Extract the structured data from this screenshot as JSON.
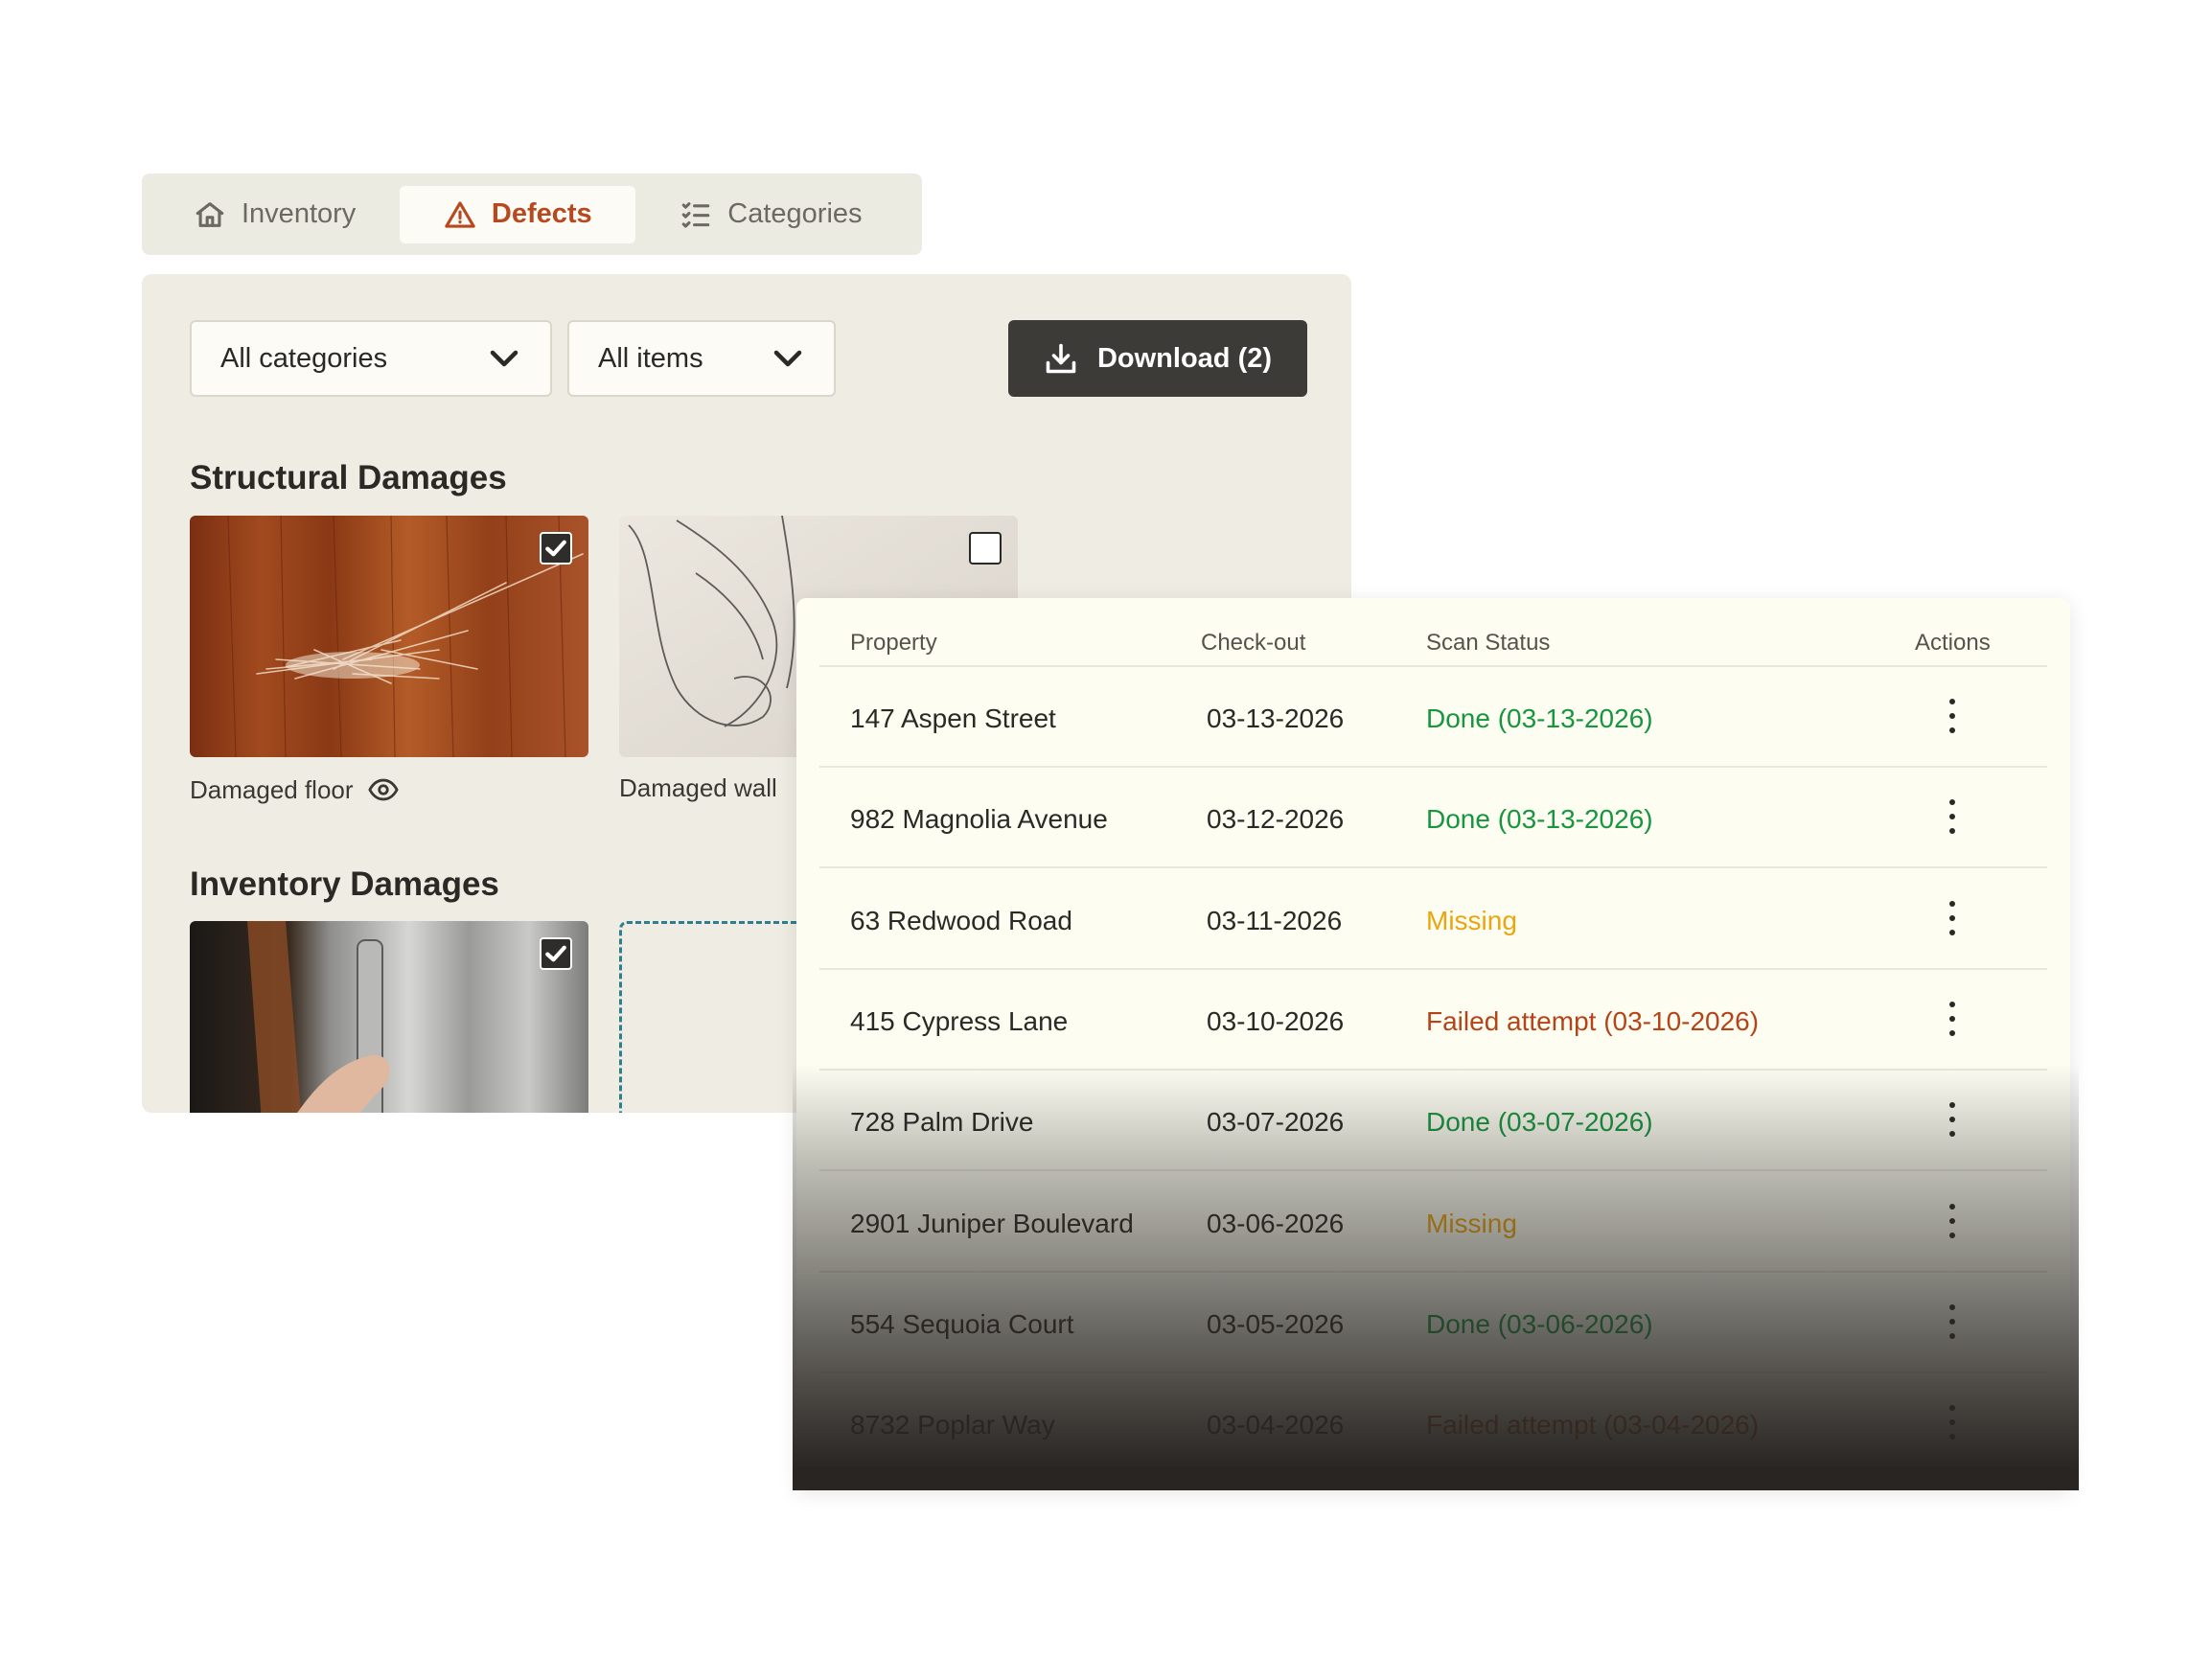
{
  "tabs": [
    {
      "label": "Inventory",
      "icon": "home-icon",
      "active": false
    },
    {
      "label": "Defects",
      "icon": "warning-icon",
      "active": true
    },
    {
      "label": "Categories",
      "icon": "checklist-icon",
      "active": false
    }
  ],
  "filters": {
    "category_select": "All categories",
    "items_select": "All items"
  },
  "download_button": "Download (2)",
  "sections": {
    "structural": {
      "title": "Structural Damages",
      "photos": [
        {
          "caption": "Damaged floor",
          "checked": true,
          "icon": "eye-icon"
        },
        {
          "caption": "Damaged wall",
          "checked": false
        }
      ]
    },
    "inventory": {
      "title": "Inventory Damages",
      "photos": [
        {
          "caption": "",
          "checked": true
        }
      ]
    }
  },
  "table": {
    "columns": [
      "Property",
      "Check-out",
      "Scan Status",
      "Actions"
    ],
    "rows": [
      {
        "property": "147 Aspen Street",
        "checkout": "03-13-2026",
        "status": "Done (03-13-2026)",
        "status_type": "done"
      },
      {
        "property": "982 Magnolia Avenue",
        "checkout": "03-12-2026",
        "status": "Done (03-13-2026)",
        "status_type": "done"
      },
      {
        "property": "63 Redwood Road",
        "checkout": "03-11-2026",
        "status": "Missing",
        "status_type": "missing"
      },
      {
        "property": "415 Cypress Lane",
        "checkout": "03-10-2026",
        "status": "Failed attempt (03-10-2026)",
        "status_type": "failed"
      },
      {
        "property": "728 Palm Drive",
        "checkout": "03-07-2026",
        "status": "Done (03-07-2026)",
        "status_type": "done"
      },
      {
        "property": "2901 Juniper Boulevard",
        "checkout": "03-06-2026",
        "status": "Missing",
        "status_type": "missing"
      },
      {
        "property": "554 Sequoia Court",
        "checkout": "03-05-2026",
        "status": "Done (03-06-2026)",
        "status_type": "done"
      },
      {
        "property": "8732 Poplar Way",
        "checkout": "03-04-2026",
        "status": "Failed attempt (03-04-2026)",
        "status_type": "failed"
      }
    ]
  },
  "colors": {
    "accent": "#b8481e",
    "done": "#17963f",
    "missing": "#e9a60f",
    "failed": "#b54518",
    "dark_button": "#3d3b38"
  }
}
